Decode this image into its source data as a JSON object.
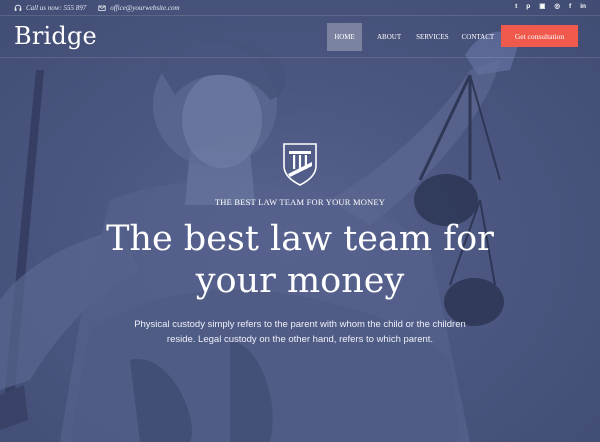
{
  "topbar": {
    "phone_text": "Call us now: 555 897",
    "email_text": "office@yourwebsite.com",
    "socials": [
      {
        "icon": "twitter-icon",
        "glyph": "t"
      },
      {
        "icon": "pinterest-icon",
        "glyph": "p"
      },
      {
        "icon": "instagram-icon",
        "glyph": "▣"
      },
      {
        "icon": "dribbble-icon",
        "glyph": "◎"
      },
      {
        "icon": "facebook-icon",
        "glyph": "f"
      },
      {
        "icon": "linkedin-icon",
        "glyph": "in"
      }
    ]
  },
  "header": {
    "logo": "Bridge",
    "nav": [
      "HOME",
      "ABOUT",
      "SERVICES",
      "CONTACT"
    ],
    "active_nav": "HOME",
    "cta_label": "Get consultation"
  },
  "hero": {
    "tagline": "THE BEST LAW TEAM FOR YOUR MONEY",
    "headline_line1": "The best law team for",
    "headline_line2": "your money",
    "sub_line1": "Physical custody simply refers to the parent with whom the child or the children",
    "sub_line2": "reside. Legal custody on the other hand, refers to which parent."
  },
  "colors": {
    "overlay": "#4a5680",
    "accent": "#ef5a4d",
    "text": "#ffffff"
  }
}
